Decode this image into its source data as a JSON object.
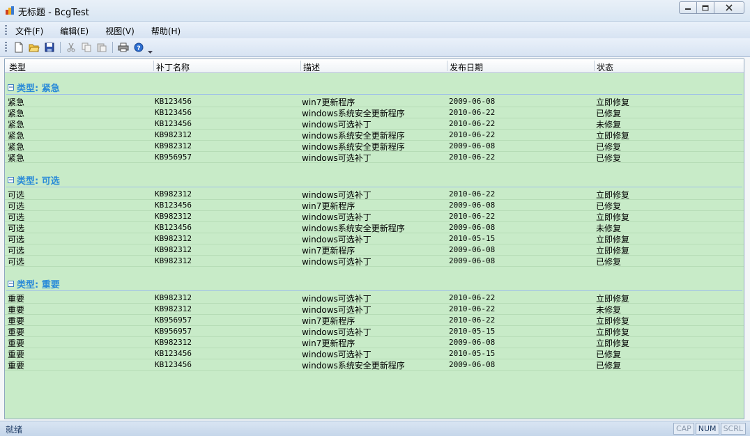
{
  "window": {
    "title": "无标题 - BcgTest"
  },
  "menu": [
    "文件(F)",
    "编辑(E)",
    "视图(V)",
    "帮助(H)"
  ],
  "columns": [
    "类型",
    "补丁名称",
    "描述",
    "发布日期",
    "状态"
  ],
  "groups": [
    {
      "title": "类型: 紧急",
      "rows": [
        [
          "紧急",
          "KB123456",
          "win7更新程序",
          "2009-06-08",
          "立即修复"
        ],
        [
          "紧急",
          "KB123456",
          "windows系统安全更新程序",
          "2010-06-22",
          "已修复"
        ],
        [
          "紧急",
          "KB123456",
          "windows可选补丁",
          "2010-06-22",
          "未修复"
        ],
        [
          "紧急",
          "KB982312",
          "windows系统安全更新程序",
          "2010-06-22",
          "立即修复"
        ],
        [
          "紧急",
          "KB982312",
          "windows系统安全更新程序",
          "2009-06-08",
          "已修复"
        ],
        [
          "紧急",
          "KB956957",
          "windows可选补丁",
          "2010-06-22",
          "已修复"
        ]
      ]
    },
    {
      "title": "类型: 可选",
      "rows": [
        [
          "可选",
          "KB982312",
          "windows可选补丁",
          "2010-06-22",
          "立即修复"
        ],
        [
          "可选",
          "KB123456",
          "win7更新程序",
          "2009-06-08",
          "已修复"
        ],
        [
          "可选",
          "KB982312",
          "windows可选补丁",
          "2010-06-22",
          "立即修复"
        ],
        [
          "可选",
          "KB123456",
          "windows系统安全更新程序",
          "2009-06-08",
          "未修复"
        ],
        [
          "可选",
          "KB982312",
          "windows可选补丁",
          "2010-05-15",
          "立即修复"
        ],
        [
          "可选",
          "KB982312",
          "win7更新程序",
          "2009-06-08",
          "立即修复"
        ],
        [
          "可选",
          "KB982312",
          "windows可选补丁",
          "2009-06-08",
          "已修复"
        ]
      ]
    },
    {
      "title": "类型: 重要",
      "rows": [
        [
          "重要",
          "KB982312",
          "windows可选补丁",
          "2010-06-22",
          "立即修复"
        ],
        [
          "重要",
          "KB982312",
          "windows可选补丁",
          "2010-06-22",
          "未修复"
        ],
        [
          "重要",
          "KB956957",
          "win7更新程序",
          "2010-06-22",
          "立即修复"
        ],
        [
          "重要",
          "KB956957",
          "windows可选补丁",
          "2010-05-15",
          "立即修复"
        ],
        [
          "重要",
          "KB982312",
          "win7更新程序",
          "2009-06-08",
          "立即修复"
        ],
        [
          "重要",
          "KB123456",
          "windows可选补丁",
          "2010-05-15",
          "已修复"
        ],
        [
          "重要",
          "KB123456",
          "windows系统安全更新程序",
          "2009-06-08",
          "已修复"
        ]
      ]
    }
  ],
  "status": {
    "text": "就绪",
    "indicators": [
      {
        "label": "CAP",
        "active": false
      },
      {
        "label": "NUM",
        "active": true
      },
      {
        "label": "SCRL",
        "active": false
      }
    ]
  },
  "icons": {
    "toolbar": [
      "new-file-icon",
      "open-folder-icon",
      "save-icon",
      "cut-icon",
      "copy-icon",
      "paste-icon",
      "print-icon",
      "help-icon"
    ]
  },
  "colors": {
    "list_background": "#c8ebc8",
    "group_title": "#2a8bd8"
  }
}
